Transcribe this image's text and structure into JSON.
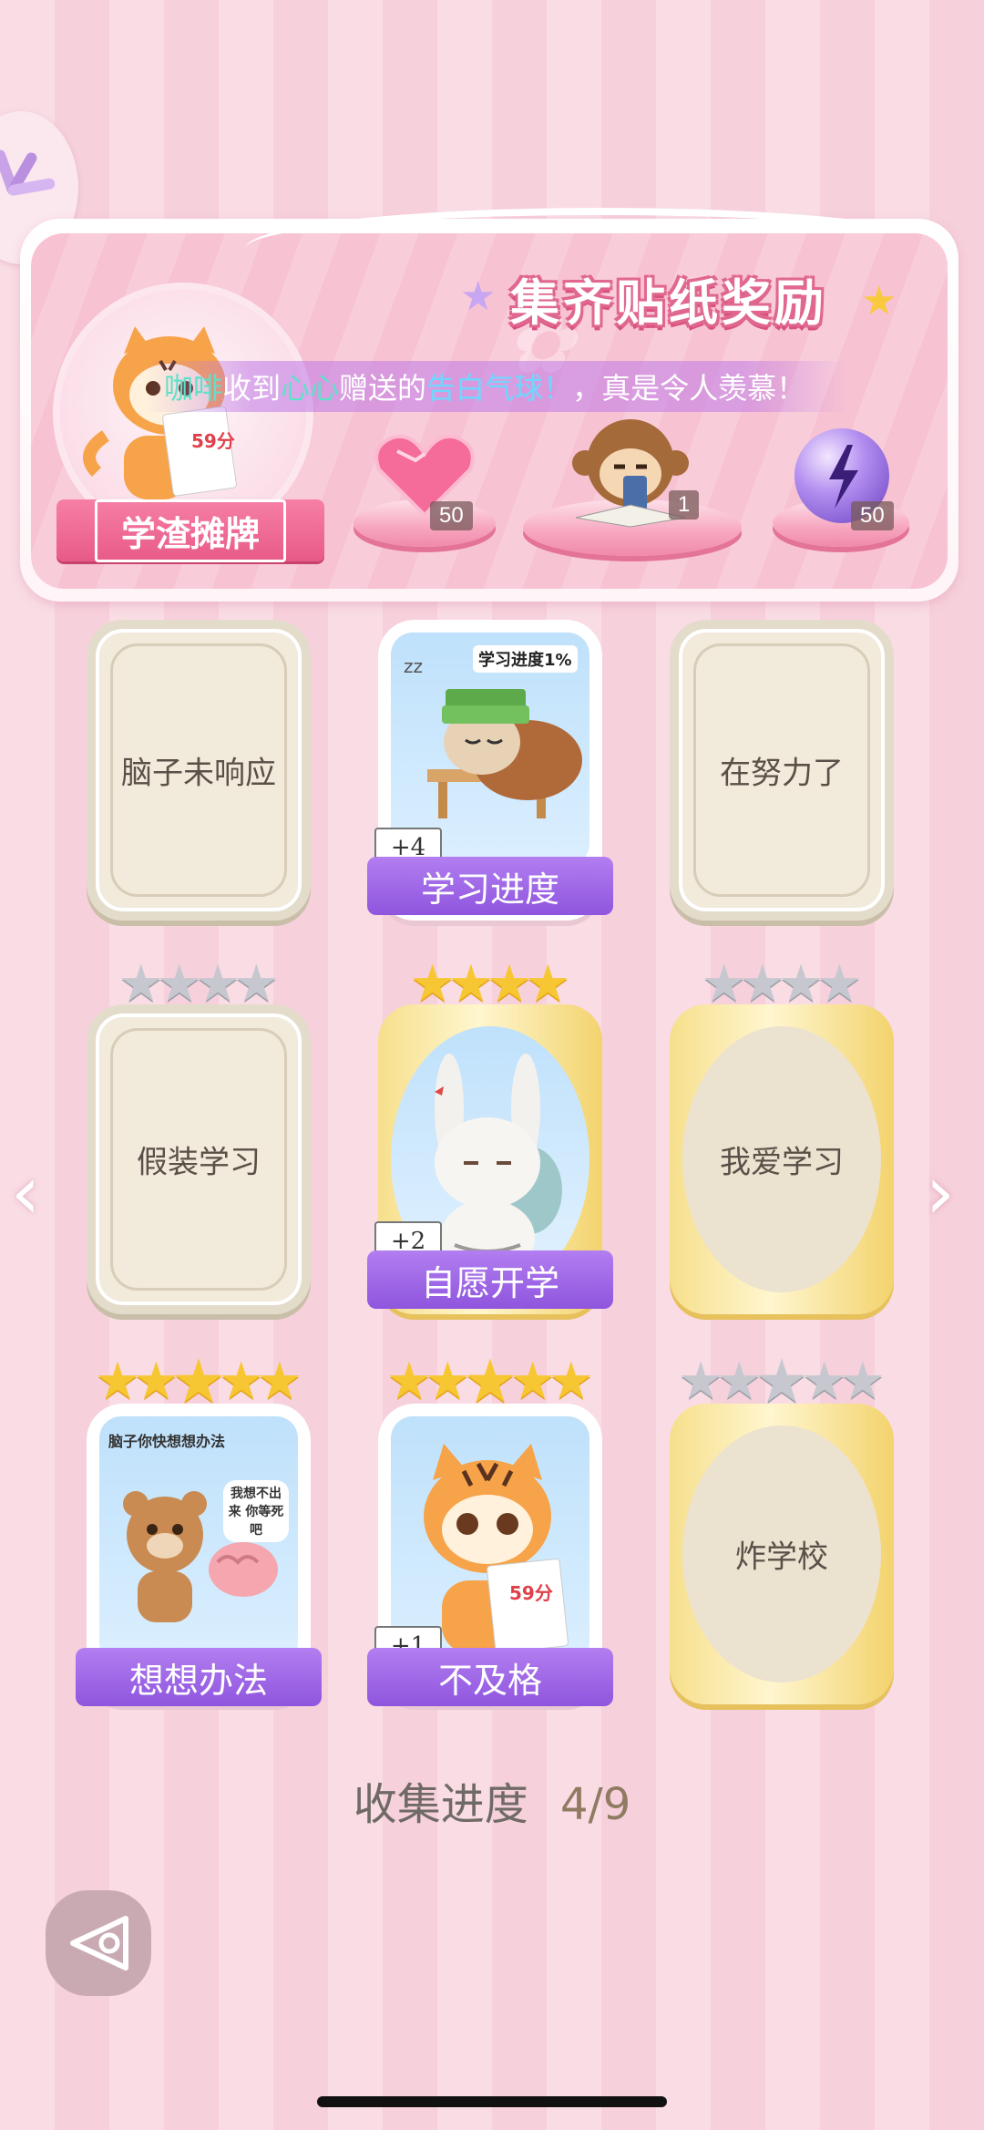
{
  "banner": {
    "title": "集齐贴纸奖励",
    "reward_badge_label": "学渣摊牌",
    "rewards": [
      {
        "icon": "pink-heart-gem-icon",
        "count": "50"
      },
      {
        "icon": "monkey-reading-sticker-icon",
        "count": "1"
      },
      {
        "icon": "purple-lightning-orb-icon",
        "count": "50"
      }
    ]
  },
  "notice": {
    "sender": "咖啡",
    "part1": "收到",
    "receiver": "心心",
    "part2": "赠送的",
    "gift": "告白气球！",
    "part3": "，真是令人羡慕！"
  },
  "cards": [
    {
      "label": "脑子未响应",
      "type": "blank",
      "stars": 0
    },
    {
      "label": "学习进度",
      "type": "photo",
      "stars": 0,
      "plus": "+4",
      "pic_caption": "学习进度1%"
    },
    {
      "label": "在努力了",
      "type": "blank",
      "stars": 0
    },
    {
      "label": "假装学习",
      "type": "blank",
      "stars": 4,
      "gold": 0
    },
    {
      "label": "自愿开学",
      "type": "photo",
      "stars": 4,
      "gold": 4,
      "plus": "+2"
    },
    {
      "label": "我爱学习",
      "type": "gold",
      "stars": 4,
      "gold": 0
    },
    {
      "label": "想想办法",
      "type": "photo",
      "stars": 5,
      "gold": 5,
      "pic_caption": "脑子你快想想办法",
      "pic_caption2": "我想不出来 你等死吧"
    },
    {
      "label": "不及格",
      "type": "photo",
      "stars": 5,
      "gold": 5,
      "plus": "+1",
      "pic_caption": "59分"
    },
    {
      "label": "炸学校",
      "type": "gold",
      "stars": 5,
      "gold": 0
    }
  ],
  "progress": {
    "label": "收集进度",
    "value": "4/9"
  },
  "tiger_score": "59分"
}
